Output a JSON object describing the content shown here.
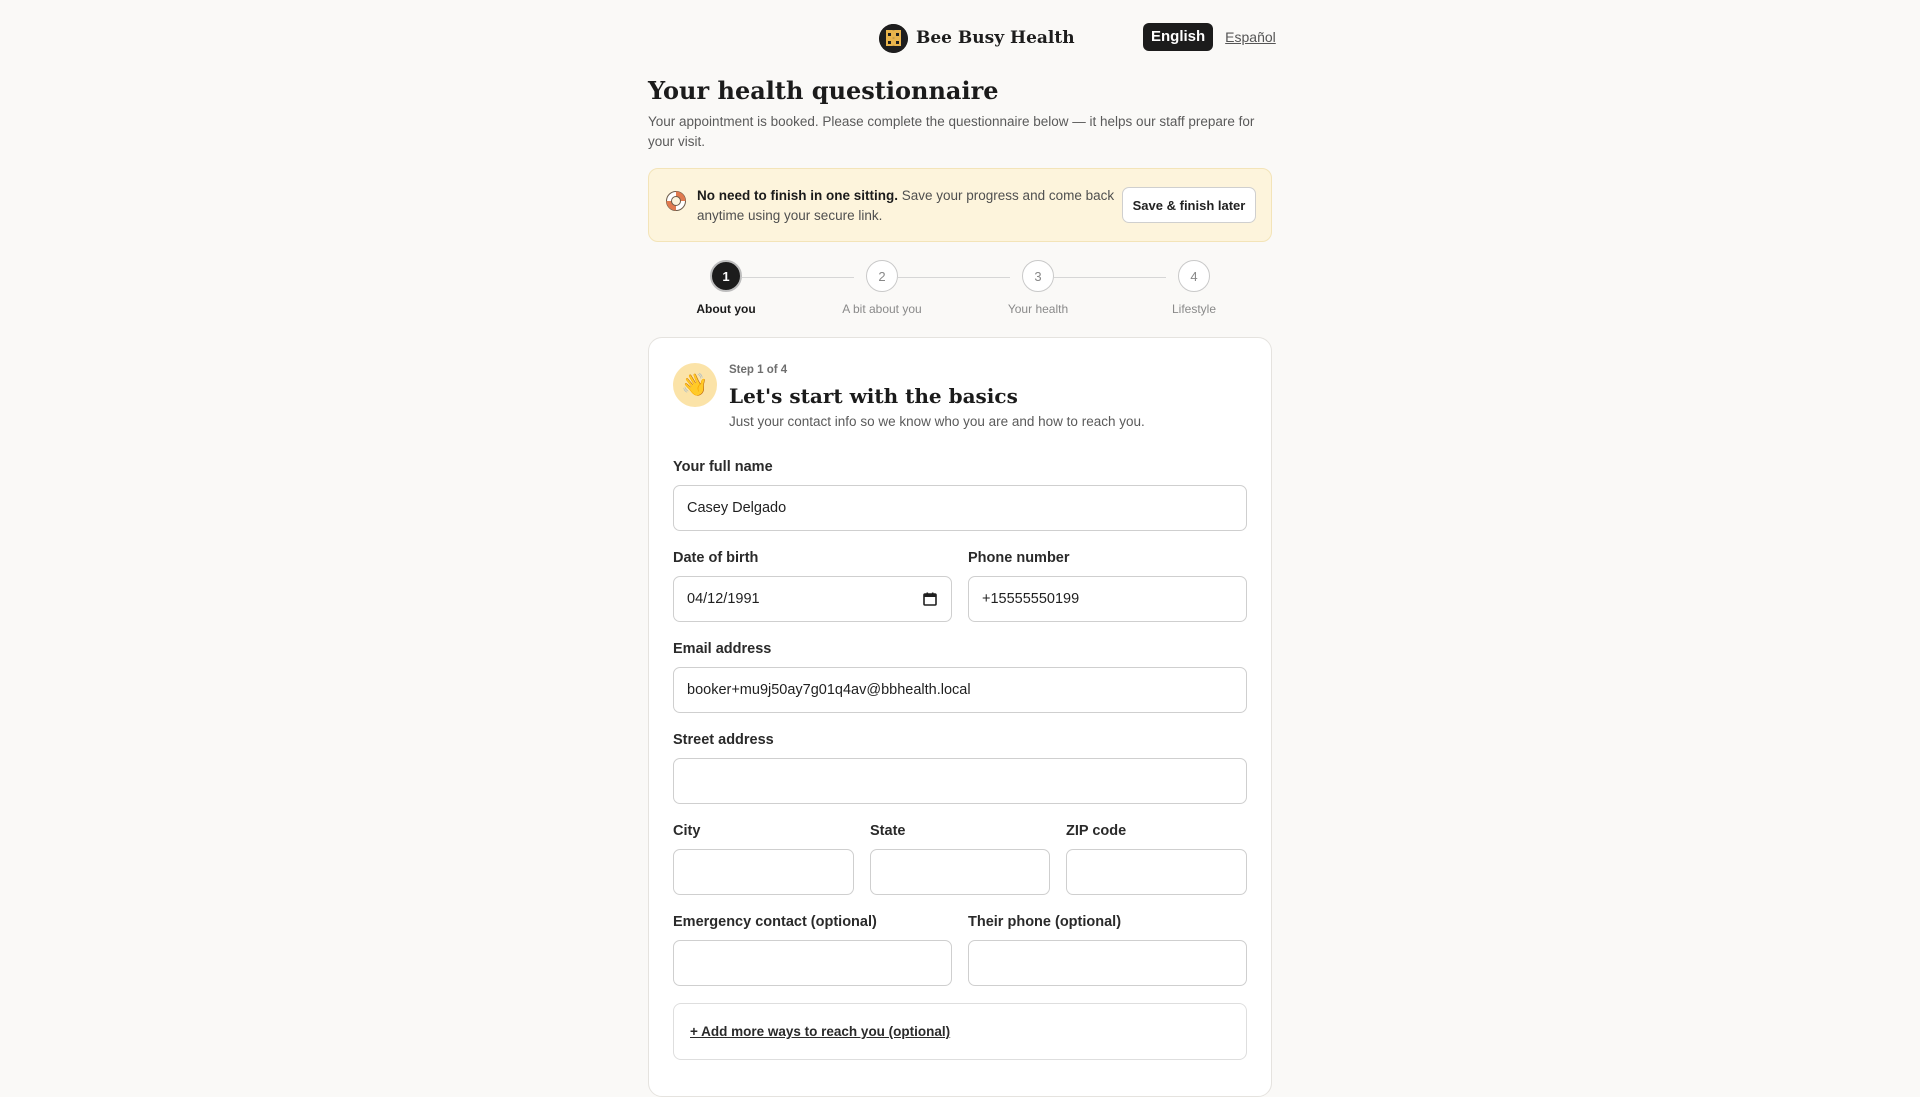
{
  "brand": {
    "name": "Bee Busy Health"
  },
  "language": {
    "active": "English",
    "alternate": "Español"
  },
  "page": {
    "title": "Your health questionnaire",
    "intro": "Your appointment is booked. Please complete the questionnaire below — it helps our staff prepare for your visit."
  },
  "banner": {
    "bold": "No need to finish in one sitting.",
    "text": " Save your progress and come back anytime using your secure link.",
    "button": "Save & finish later",
    "icon": "lifebuoy-icon"
  },
  "stepper": {
    "current": 1,
    "steps": [
      {
        "num": "1",
        "label": "About you"
      },
      {
        "num": "2",
        "label": "A bit about you"
      },
      {
        "num": "3",
        "label": "Your health"
      },
      {
        "num": "4",
        "label": "Lifestyle"
      }
    ]
  },
  "card": {
    "icon": "👋",
    "step_of": "Step 1 of 4",
    "title": "Let's start with the basics",
    "subtitle": "Just your contact info so we know who you are and how to reach you."
  },
  "form": {
    "full_name": {
      "label": "Your full name",
      "value": "Casey Delgado"
    },
    "dob": {
      "label": "Date of birth",
      "value": "04/12/1991"
    },
    "phone": {
      "label": "Phone number",
      "value": "+15555550199"
    },
    "email": {
      "label": "Email address",
      "value": "booker+mu9j50ay7g01q4av@bbhealth.local"
    },
    "street": {
      "label": "Street address",
      "value": ""
    },
    "city": {
      "label": "City",
      "value": ""
    },
    "state": {
      "label": "State",
      "value": ""
    },
    "zip": {
      "label": "ZIP code",
      "value": ""
    },
    "emergency": {
      "label": "Emergency contact (optional)",
      "value": ""
    },
    "their_phone": {
      "label": "Their phone (optional)",
      "value": ""
    },
    "add_more": "+ Add more ways to reach you (optional)"
  }
}
